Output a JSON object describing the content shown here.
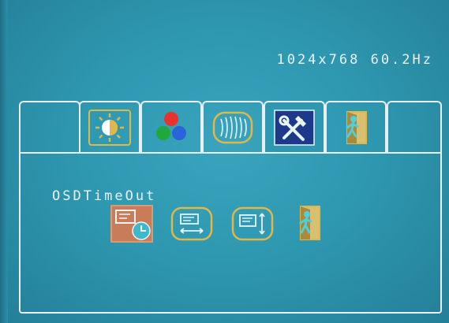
{
  "status": {
    "resolution": "1024x768 60.2Hz"
  },
  "tabs": [
    {
      "icon": "blank-tab"
    },
    {
      "icon": "brightness-icon"
    },
    {
      "icon": "color-icon"
    },
    {
      "icon": "geometry-icon"
    },
    {
      "icon": "tools-icon",
      "selected": true
    },
    {
      "icon": "exit-door-icon"
    },
    {
      "icon": "blank-tab"
    }
  ],
  "section": {
    "label": "OSDTimeOut",
    "items": [
      {
        "icon": "osd-timeout-clock-icon",
        "selected": true
      },
      {
        "icon": "horizontal-position-icon"
      },
      {
        "icon": "vertical-position-icon"
      },
      {
        "icon": "exit-door-icon"
      }
    ]
  },
  "colors": {
    "background": "#2f98b1",
    "border": "#e9eef0",
    "icon_outline": "#e0b84a",
    "selected_tab": "#1d3a8a",
    "selected_item": "#c97c5a"
  }
}
